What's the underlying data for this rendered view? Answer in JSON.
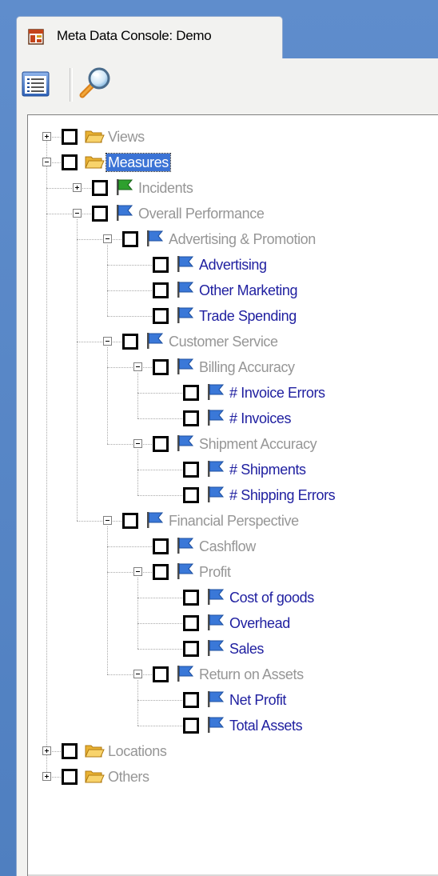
{
  "window": {
    "tab_title": "Meta Data Console: Demo"
  },
  "toolbar": {
    "buttons": [
      {
        "name": "list-view-button",
        "icon": "list-icon"
      },
      {
        "name": "search-button",
        "icon": "magnifier-icon"
      }
    ]
  },
  "colors": {
    "background_blue": "#5b86c4",
    "panel": "#f2f2f0",
    "tree_bg": "#ffffff",
    "label_gray": "#969696",
    "label_blue": "#1f1fa0",
    "selection": "#3b73d5",
    "flag_green": "#2ea02e",
    "flag_blue": "#3a78d8",
    "folder_yellow": "#f5c542"
  },
  "tree": {
    "nodes": [
      {
        "id": "views",
        "label": "Views",
        "icon": "folder-icon",
        "expander": "plus",
        "style": "gray",
        "checked": false
      },
      {
        "id": "measures",
        "label": "Measures",
        "icon": "folder-icon",
        "expander": "minus",
        "style": "selected",
        "checked": false
      },
      {
        "id": "incidents",
        "label": "Incidents",
        "icon": "green-flag-icon",
        "expander": "plus",
        "style": "gray",
        "checked": false
      },
      {
        "id": "overall-performance",
        "label": "Overall Performance",
        "icon": "blue-flag-icon",
        "expander": "minus",
        "style": "gray",
        "checked": false
      },
      {
        "id": "advertising-promotion",
        "label": "Advertising & Promotion",
        "icon": "blue-flag-icon",
        "expander": "minus",
        "style": "gray",
        "checked": false
      },
      {
        "id": "advertising",
        "label": "Advertising",
        "icon": "blue-flag-icon",
        "expander": "none",
        "style": "blue",
        "checked": false
      },
      {
        "id": "other-marketing",
        "label": "Other Marketing",
        "icon": "blue-flag-icon",
        "expander": "none",
        "style": "blue",
        "checked": false
      },
      {
        "id": "trade-spending",
        "label": "Trade Spending",
        "icon": "blue-flag-icon",
        "expander": "none",
        "style": "blue",
        "checked": false
      },
      {
        "id": "customer-service",
        "label": "Customer Service",
        "icon": "blue-flag-icon",
        "expander": "minus",
        "style": "gray",
        "checked": false
      },
      {
        "id": "billing-accuracy",
        "label": "Billing Accuracy",
        "icon": "blue-flag-icon",
        "expander": "minus",
        "style": "gray",
        "checked": false
      },
      {
        "id": "invoice-errors",
        "label": "# Invoice Errors",
        "icon": "blue-flag-icon",
        "expander": "none",
        "style": "blue",
        "checked": false
      },
      {
        "id": "invoices",
        "label": "# Invoices",
        "icon": "blue-flag-icon",
        "expander": "none",
        "style": "blue",
        "checked": false
      },
      {
        "id": "shipment-accuracy",
        "label": "Shipment Accuracy",
        "icon": "blue-flag-icon",
        "expander": "minus",
        "style": "gray",
        "checked": false
      },
      {
        "id": "shipments",
        "label": "# Shipments",
        "icon": "blue-flag-icon",
        "expander": "none",
        "style": "blue",
        "checked": false
      },
      {
        "id": "shipping-errors",
        "label": "# Shipping Errors",
        "icon": "blue-flag-icon",
        "expander": "none",
        "style": "blue",
        "checked": false
      },
      {
        "id": "financial-perspective",
        "label": "Financial Perspective",
        "icon": "blue-flag-icon",
        "expander": "minus",
        "style": "gray",
        "checked": false
      },
      {
        "id": "cashflow",
        "label": "Cashflow",
        "icon": "blue-flag-icon",
        "expander": "none",
        "style": "gray",
        "checked": false
      },
      {
        "id": "profit",
        "label": "Profit",
        "icon": "blue-flag-icon",
        "expander": "minus",
        "style": "gray",
        "checked": false
      },
      {
        "id": "cost-of-goods",
        "label": "Cost of goods",
        "icon": "blue-flag-icon",
        "expander": "none",
        "style": "blue",
        "checked": false
      },
      {
        "id": "overhead",
        "label": "Overhead",
        "icon": "blue-flag-icon",
        "expander": "none",
        "style": "blue",
        "checked": false
      },
      {
        "id": "sales",
        "label": "Sales",
        "icon": "blue-flag-icon",
        "expander": "none",
        "style": "blue",
        "checked": false
      },
      {
        "id": "return-on-assets",
        "label": "Return on Assets",
        "icon": "blue-flag-icon",
        "expander": "minus",
        "style": "gray",
        "checked": false
      },
      {
        "id": "net-profit",
        "label": "Net Profit",
        "icon": "blue-flag-icon",
        "expander": "none",
        "style": "blue",
        "checked": false
      },
      {
        "id": "total-assets",
        "label": "Total Assets",
        "icon": "blue-flag-icon",
        "expander": "none",
        "style": "blue",
        "checked": false
      },
      {
        "id": "locations",
        "label": "Locations",
        "icon": "folder-icon",
        "expander": "plus",
        "style": "gray",
        "checked": false
      },
      {
        "id": "others",
        "label": "Others",
        "icon": "folder-icon",
        "expander": "plus",
        "style": "gray",
        "checked": false
      }
    ]
  }
}
